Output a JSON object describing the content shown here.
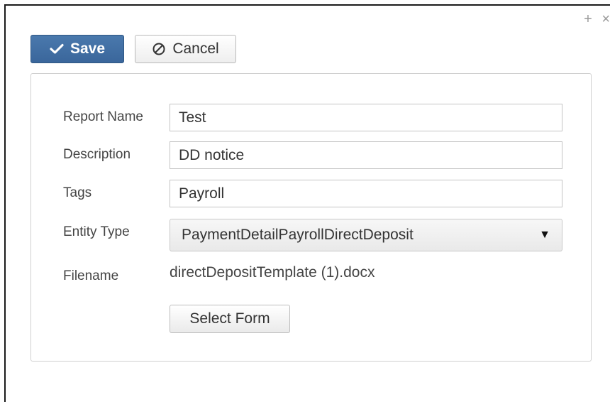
{
  "window": {
    "add_icon": "+",
    "close_icon": "×"
  },
  "toolbar": {
    "save_label": "Save",
    "cancel_label": "Cancel"
  },
  "form": {
    "report_name": {
      "label": "Report Name",
      "value": "Test"
    },
    "description": {
      "label": "Description",
      "value": "DD notice"
    },
    "tags": {
      "label": "Tags",
      "value": "Payroll"
    },
    "entity_type": {
      "label": "Entity Type",
      "value": "PaymentDetailPayrollDirectDeposit"
    },
    "filename": {
      "label": "Filename",
      "value": "directDepositTemplate (1).docx"
    },
    "select_form_label": "Select Form"
  },
  "colors": {
    "save_button": "#3d6ba0",
    "panel_border": "#cfcfcf"
  }
}
